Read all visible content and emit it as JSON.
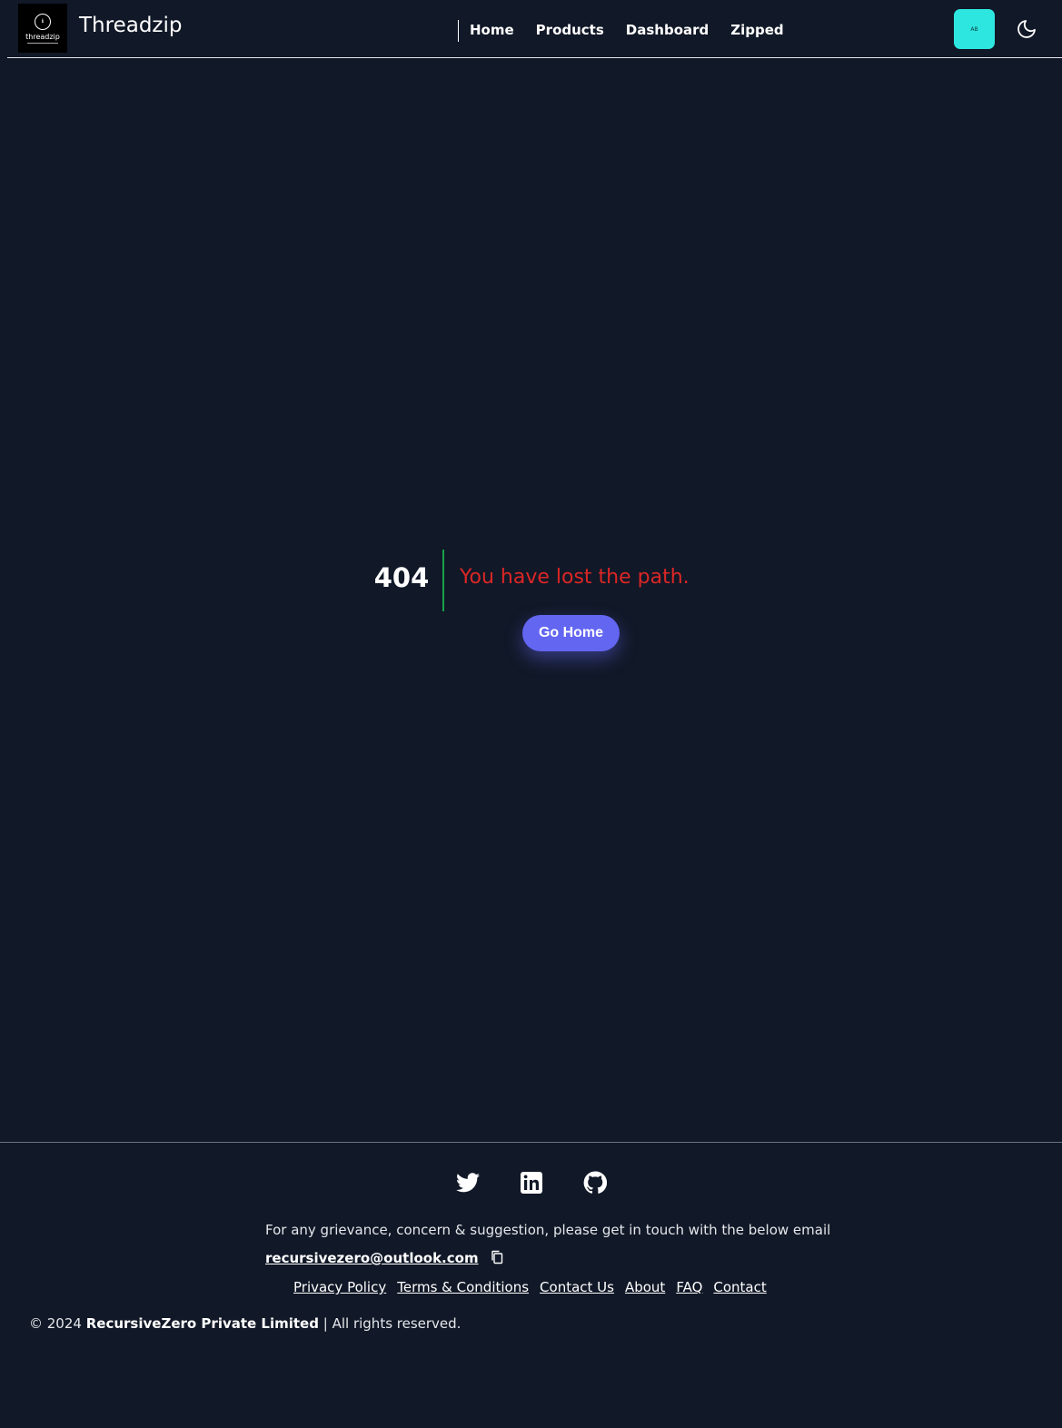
{
  "header": {
    "logo_symbol": "ℹ",
    "logo_text": "threadzip",
    "brand": "Threadzip",
    "nav": [
      {
        "label": "Home"
      },
      {
        "label": "Products"
      },
      {
        "label": "Dashboard"
      },
      {
        "label": "Zipped"
      }
    ],
    "user_initials": "AB",
    "accent_color": "#2ee6e0"
  },
  "error": {
    "code": "404",
    "message": "You have lost the path.",
    "button_label": "Go Home",
    "message_color": "#dc2626",
    "divider_color": "#16a34a",
    "button_color": "#6366f1"
  },
  "footer": {
    "social": [
      "twitter-icon",
      "linkedin-icon",
      "github-icon"
    ],
    "grievance": "For any grievance, concern & suggestion, please get in touch with the below email",
    "email": "recursivezero@outlook.com",
    "links": [
      {
        "label": "Privacy Policy"
      },
      {
        "label": "Terms & Conditions"
      },
      {
        "label": "Contact Us"
      },
      {
        "label": "About"
      },
      {
        "label": "FAQ"
      },
      {
        "label": "Contact"
      }
    ],
    "copyright_prefix": "© 2024",
    "company": "RecursiveZero Private Limited",
    "copyright_suffix": "| All rights reserved."
  }
}
